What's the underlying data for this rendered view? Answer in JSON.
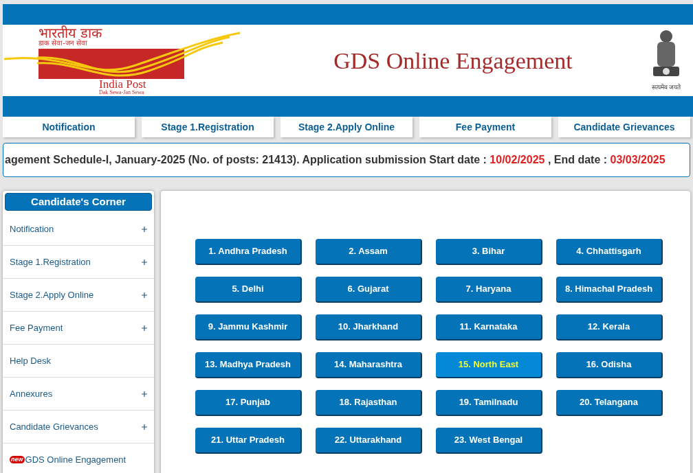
{
  "header": {
    "logo": {
      "hindi_title": "भारतीय डाक",
      "hindi_tagline": "डाक सेवा-जन सेवा",
      "name": "India Post",
      "tagline": "Dak Sewa-Jan Sewa"
    },
    "title": "GDS Online Engagement",
    "emblem_motto": "सत्यमेव जयते"
  },
  "nav": [
    "Notification",
    "Stage 1.Registration",
    "Stage 2.Apply Online",
    "Fee Payment",
    "Candidate Grievances"
  ],
  "marquee": [
    {
      "text": "agement Schedule-I, January-2025 (No. of posts: 21413). Application submission Start date : ",
      "highlight": false
    },
    {
      "text": "10/02/2025",
      "highlight": true
    },
    {
      "text": " , End date : ",
      "highlight": false
    },
    {
      "text": "03/03/2025",
      "highlight": true
    }
  ],
  "sidebar": {
    "title": "Candidate's Corner",
    "items": [
      {
        "label": "Notification",
        "expandable": true
      },
      {
        "label": "Stage 1.Registration",
        "expandable": true
      },
      {
        "label": "Stage 2.Apply Online",
        "expandable": true
      },
      {
        "label": "Fee Payment",
        "expandable": true
      },
      {
        "label": "Help Desk",
        "expandable": false
      },
      {
        "label": "Annexures",
        "expandable": true
      },
      {
        "label": "Candidate Grievances",
        "expandable": true
      },
      {
        "label": "GDS Online Engagement",
        "expandable": false,
        "badge": "new"
      }
    ]
  },
  "states": [
    {
      "label": "1. Andhra Pradesh",
      "selected": false
    },
    {
      "label": "2. Assam",
      "selected": false
    },
    {
      "label": "3. Bihar",
      "selected": false
    },
    {
      "label": "4. Chhattisgarh",
      "selected": false
    },
    {
      "label": "5. Delhi",
      "selected": false
    },
    {
      "label": "6. Gujarat",
      "selected": false
    },
    {
      "label": "7. Haryana",
      "selected": false
    },
    {
      "label": "8. Himachal Pradesh",
      "selected": false
    },
    {
      "label": "9. Jammu Kashmir",
      "selected": false
    },
    {
      "label": "10. Jharkhand",
      "selected": false
    },
    {
      "label": "11. Karnataka",
      "selected": false
    },
    {
      "label": "12. Kerala",
      "selected": false
    },
    {
      "label": "13. Madhya Pradesh",
      "selected": false
    },
    {
      "label": "14. Maharashtra",
      "selected": false
    },
    {
      "label": "15. North East",
      "selected": true
    },
    {
      "label": "16. Odisha",
      "selected": false
    },
    {
      "label": "17. Punjab",
      "selected": false
    },
    {
      "label": "18. Rajasthan",
      "selected": false
    },
    {
      "label": "19. Tamilnadu",
      "selected": false
    },
    {
      "label": "20. Telangana",
      "selected": false
    },
    {
      "label": "21. Uttar Pradesh",
      "selected": false
    },
    {
      "label": "22. Uttarakhand",
      "selected": false
    },
    {
      "label": "23. West Bengal",
      "selected": false
    }
  ]
}
